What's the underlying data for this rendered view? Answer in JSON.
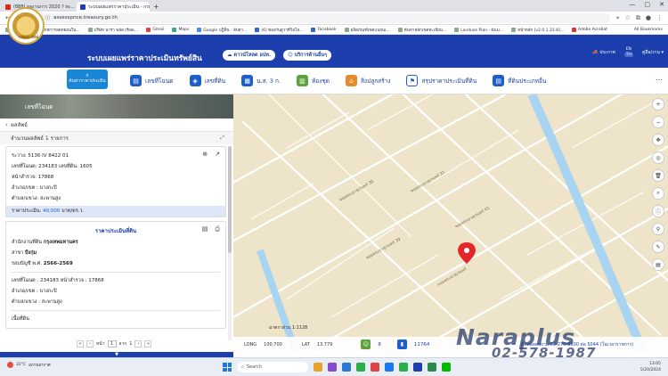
{
  "browser": {
    "tabs": [
      {
        "label": "(888) ผลงานการ 2020 ? ทะ...",
        "color": "#e62117",
        "active": false
      },
      {
        "label": "ระบบเผยแพร่ราคาประเมิน - กรมธนา...",
        "color": "#1d3fae",
        "active": true
      }
    ],
    "url": "assessprice.treasury.go.th",
    "bookmarks": [
      "Apps",
      "ประเภทการลดหย่อนใน...",
      "บริษัท นารา พลัส เรียลเ...",
      "Gmail",
      "Maps",
      "Google ปฏิทิน - สัปดา...",
      "(6) ซองกันสู่วาที่วิลโล...",
      "Facebook",
      "ผลิตภัณฑ์เขตแปลนเ...",
      "ค้นหาหลักเขตทะเบียน...",
      "Landuse Plan - ผังเม...",
      "หน้าหลัก [v2.0.1.33.8]...",
      "Adobe Acrobat"
    ],
    "all_bookmarks": "All Bookmarks"
  },
  "header": {
    "logo_text": "กรมธนารักษ์",
    "title": "ระบบเผยแพร่ราคาประเมินทรัพย์สิน",
    "download_btn": "ดาวน์โหลด อปท.",
    "service_btn": "บริการด้านอื่นๆ",
    "announce": "ประกาศ",
    "lang_en": "EN",
    "lang_th": "TH",
    "manual": "คู่มือ/งาน",
    "search_badge": "ค้นหาราคาประเมิน"
  },
  "nav": {
    "items": [
      {
        "label": "เลขที่โฉนด",
        "icon": "▤"
      },
      {
        "label": "เลขที่ดิน",
        "icon": "◈"
      },
      {
        "label": "น.ส. 3 ก.",
        "icon": "▦"
      },
      {
        "label": "ห้องชุด",
        "icon": "▥"
      },
      {
        "label": "สิ่งปลูกสร้าง",
        "icon": "⌂"
      },
      {
        "label": "สรุปราคาประเมินที่ดิน",
        "icon": "⚑"
      },
      {
        "label": "ที่ดินประเภทอื่น",
        "icon": "▤"
      }
    ],
    "more": "⋯"
  },
  "panel": {
    "photo_label": "เลขที่โฉนด",
    "back_label": "ผลลัพธ์",
    "result_count": "จำนวนผลลัพธ์ 1 รายการ",
    "card1": {
      "lines": [
        "ระวาง: 5136 IV 8422 01",
        "เลขที่โฉนด: 234183 เลขที่ดิน: 1605",
        "หน้าสำรวจ: 17868",
        "อำเภอ/เขต : บางกะปิ",
        "ตำบล/แขวง: สะพานสูง"
      ],
      "price_label": "ราคาประเมิน:",
      "price_value": "40,000",
      "price_unit": "บาท/ตร.ว."
    },
    "card2": {
      "title": "ราคาประเมินที่ดิน",
      "office_label": "สำนักงานที่ดิน",
      "office_value": "กรุงเทพมหานคร",
      "branch_label": "สาขา",
      "branch_value": "บึงกุ่ม",
      "period_label": "รอบบัญชี พ.ศ.",
      "period_value": "2566-2569",
      "lines": [
        "เลขที่โฉนด : 234183 หน้าสำรวจ : 17868",
        "อำเภอ/เขต : บางกะปิ",
        "ตำบล/แขวง : สะพานสูง"
      ],
      "more": "เนื้อที่ดิน"
    },
    "pager": {
      "page_label": "หน้า",
      "page": "1",
      "of_label": "จาก",
      "total": "1"
    },
    "footer": "▼"
  },
  "map": {
    "scale": "มาตราส่วน 1:1128",
    "streets": [
      "ซอยพระยาสุเรนทร์ 35",
      "ซอยพระยาสุเรนทร์ 37",
      "ซอยพระยาสุเรนทร์ 39",
      "ซอยพระยาสุเรนทร์ 41",
      "ถนนพระยาสุเรนทร์"
    ],
    "status": {
      "long_label": "LONG",
      "long_value": "100.700",
      "lat_label": "LAT",
      "lat_value": "13.779",
      "visits_a": "8",
      "visits_b": "11764"
    },
    "contact": "ติดต่อสอบถาม 02-270-8800 ต่อ 5044 (ในเวลาราชการ)"
  },
  "watermark": {
    "line1": "Naraplus",
    "line2": "02-578-1987"
  },
  "taskbar": {
    "weather_temp": "32°C",
    "weather_text": "สภาพอากาศ",
    "search": "Search",
    "time": "13:05",
    "date": "5/20/2024"
  }
}
